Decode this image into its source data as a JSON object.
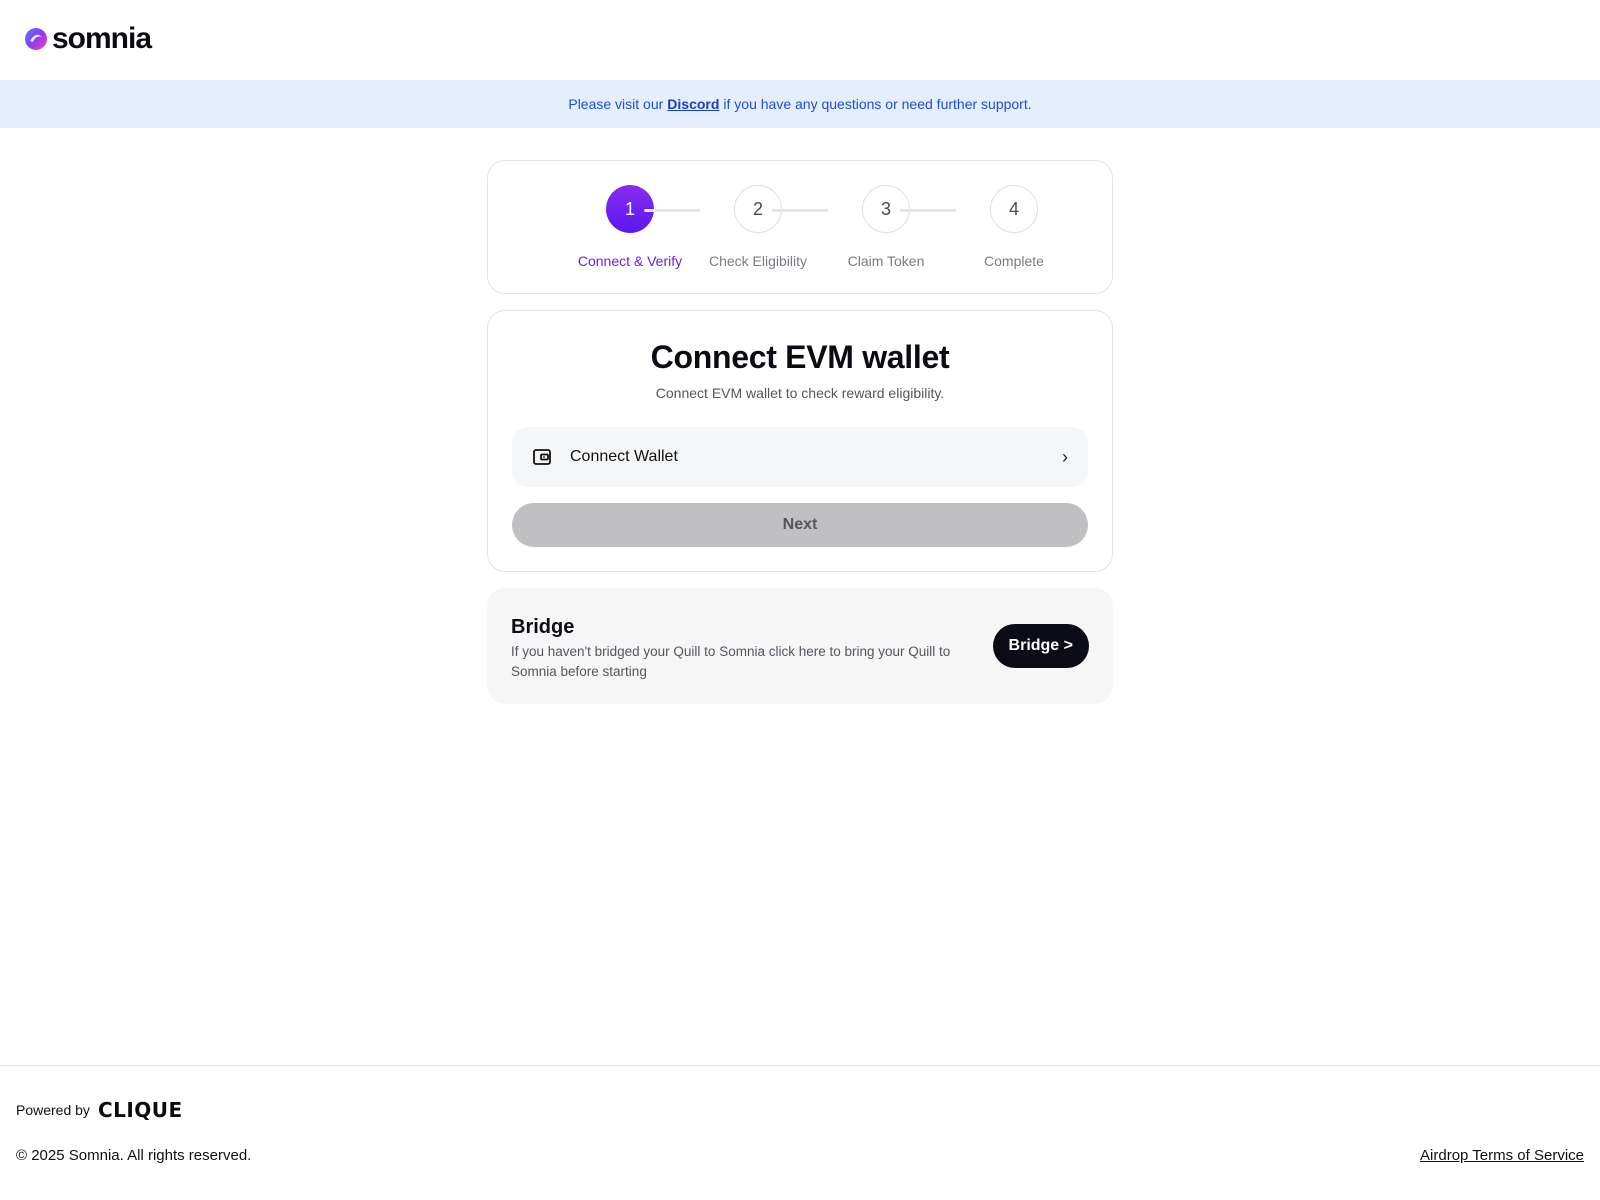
{
  "header": {
    "logo_text": "somnia",
    "logo_icon": "somnia-logo-icon"
  },
  "banner": {
    "prefix": "Please visit our",
    "link_text": "Discord",
    "suffix": "if you have any questions or need further support."
  },
  "stepper": {
    "steps": [
      {
        "number": "1",
        "label": "Connect & Verify",
        "active": true
      },
      {
        "number": "2",
        "label": "Check Eligibility",
        "active": false
      },
      {
        "number": "3",
        "label": "Claim Token",
        "active": false
      },
      {
        "number": "4",
        "label": "Complete",
        "active": false
      }
    ]
  },
  "main": {
    "title": "Connect EVM wallet",
    "subtitle": "Connect EVM wallet to check reward eligibility.",
    "wallet_button_label": "Connect Wallet",
    "wallet_icon": "wallet-icon",
    "chevron": "›",
    "next_label": "Next"
  },
  "bridge": {
    "title": "Bridge",
    "description": "If you haven't bridged your Quill to Somnia click here to bring your Quill to Somnia before starting",
    "button_label": "Bridge >"
  },
  "footer": {
    "powered_by": "Powered by",
    "brand": "CLIQUE",
    "copyright": "© 2025 Somnia. All rights reserved.",
    "terms": "Airdrop Terms of Service"
  },
  "colors": {
    "accent": "#6a22e6",
    "banner_bg": "#e4eefc",
    "banner_text": "#1c4fd8",
    "bridge_button": "#0b0c16",
    "disabled_button": "#c0c0c2"
  }
}
